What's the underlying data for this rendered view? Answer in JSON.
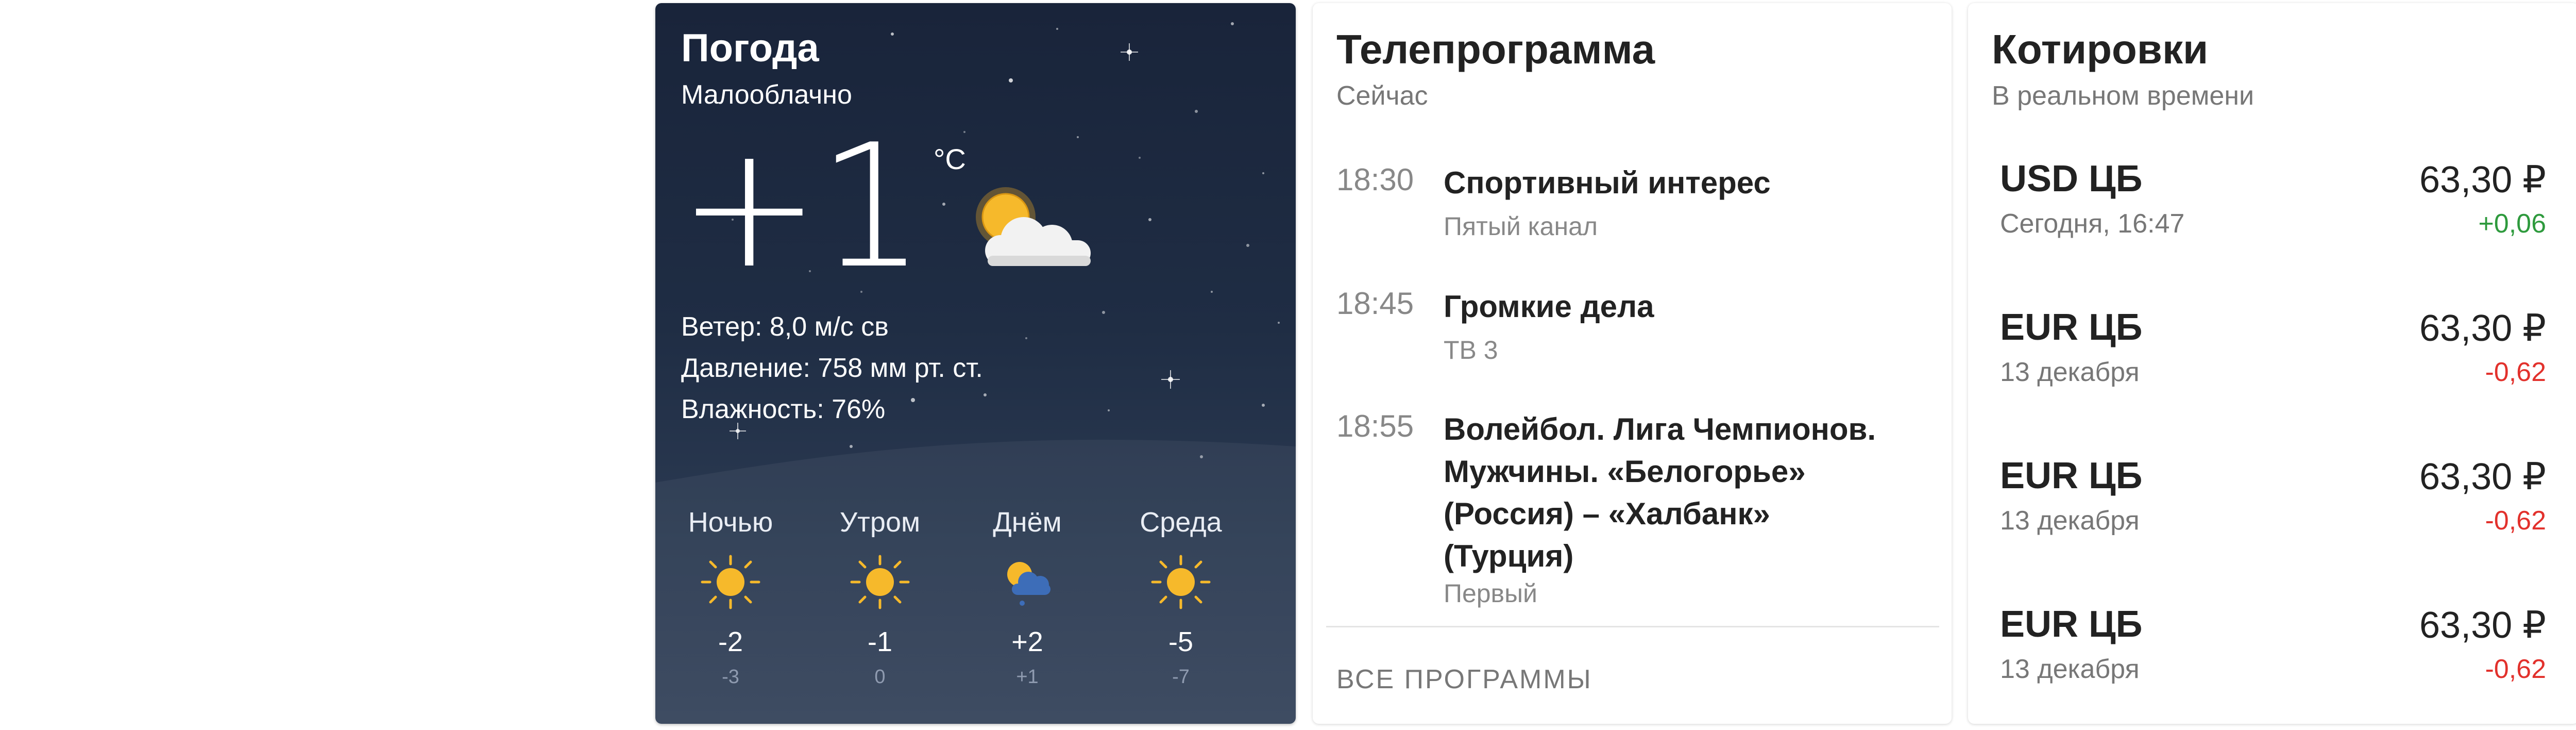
{
  "weather": {
    "title": "Погода",
    "condition": "Малооблачно",
    "temperature": "+1",
    "unit": "°C",
    "main_icon": "partly-cloudy-sun-icon",
    "details": [
      "Ветер: 8,0 м/с св",
      "Давление: 758 мм рт. ст.",
      "Влажность: 76%"
    ],
    "forecast": [
      {
        "label": "Ночью",
        "icon": "sun-icon",
        "hi": "-2",
        "lo": "-3"
      },
      {
        "label": "Утром",
        "icon": "sun-icon",
        "hi": "-1",
        "lo": "0"
      },
      {
        "label": "Днём",
        "icon": "sun-cloud-snow-icon",
        "hi": "+2",
        "lo": "+1"
      },
      {
        "label": "Среда",
        "icon": "sun-icon",
        "hi": "-5",
        "lo": "-7"
      }
    ]
  },
  "tv": {
    "title": "Телепрограмма",
    "subtitle": "Сейчас",
    "items": [
      {
        "time": "18:30",
        "name": "Спортивный интерес",
        "channel": "Пятый канал"
      },
      {
        "time": "18:45",
        "name": "Громкие дела",
        "channel": "ТВ 3"
      },
      {
        "time": "18:55",
        "name": "Волейбол. Лига Чемпионов. Мужчины. «Белогорье» (Россия) – «Халбанк» (Турция)",
        "channel": "Первый"
      }
    ],
    "all_label": "ВСЕ ПРОГРАММЫ"
  },
  "quotes": {
    "title": "Котировки",
    "subtitle": "В реальном времени",
    "items": [
      {
        "name": "USD ЦБ",
        "date": "Сегодня, 16:47",
        "value": "63,30 ₽",
        "change": "+0,06"
      },
      {
        "name": "EUR ЦБ",
        "date": "13 декабря",
        "value": "63,30 ₽",
        "change": "-0,62"
      },
      {
        "name": "EUR ЦБ",
        "date": "13 декабря",
        "value": "63,30 ₽",
        "change": "-0,62"
      },
      {
        "name": "EUR ЦБ",
        "date": "13 декабря",
        "value": "63,30 ₽",
        "change": "-0,62"
      }
    ],
    "colors": {
      "up": "#2e9a3d",
      "down": "#e2312c"
    }
  }
}
